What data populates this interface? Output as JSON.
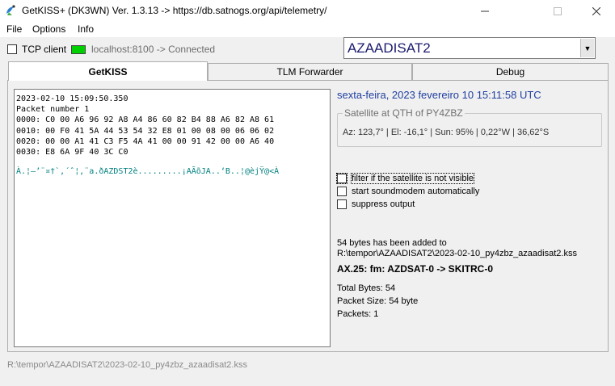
{
  "window": {
    "title": "GetKISS+ (DK3WN) Ver. 1.3.13 -> https://db.satnogs.org/api/telemetry/"
  },
  "menu": [
    "File",
    "Options",
    "Info"
  ],
  "connection": {
    "tcp_label": "TCP client",
    "tcp_checked": false,
    "status_text": "localhost:8100 -> Connected",
    "led_color": "#00d000"
  },
  "satellite_select": {
    "value": "AZAADISAT2"
  },
  "tabs": [
    {
      "label": "GetKISS",
      "active": true
    },
    {
      "label": "TLM Forwarder",
      "active": false
    },
    {
      "label": "Debug",
      "active": false
    }
  ],
  "log": {
    "lines": [
      "2023-02-10 15:09:50.350",
      "Packet number 1",
      "0000: C0 00 A6 96 92 A8 A4 86 60 82 B4 88 A6 82 A8 61",
      "0010: 00 F0 41 5A 44 53 54 32 E8 01 00 08 00 06 06 02",
      "0020: 00 00 A1 41 C3 F5 4A 41 00 00 91 42 00 00 A6 40",
      "0030: E8 6A 9F 40 3C C0"
    ],
    "ascii": "À.¦–’¨¤†`‚´ˆ¦‚¨a.ðAZDST2è.........¡AÃõJA..‘B..¦@èjŸ@<À"
  },
  "datetime": "sexta-feira, 2023 fevereiro 10  15:11:58 UTC",
  "satellite_group": {
    "title": "Satellite at QTH of PY4ZBZ",
    "values": "Az: 123,7° | El: -16,1° | Sun: 95% | 0,22°W | 36,62°S"
  },
  "options": [
    {
      "label": "filter if the satellite is not visible",
      "checked": false
    },
    {
      "label": "start soundmodem automatically",
      "checked": false
    },
    {
      "label": "suppress output",
      "checked": false
    }
  ],
  "added": {
    "line1": "54 bytes has been added to",
    "line2": "R:\\tempor\\AZAADISAT2\\2023-02-10_py4zbz_azaadisat2.kss"
  },
  "ax25": "AX.25: fm: AZDSAT-0 -> SKITRC-0",
  "stats": {
    "total_bytes": "Total Bytes: 54",
    "packet_size": "Packet Size: 54 byte",
    "packets": "Packets: 1"
  },
  "statusbar": "R:\\tempor\\AZAADISAT2\\2023-02-10_py4zbz_azaadisat2.kss"
}
